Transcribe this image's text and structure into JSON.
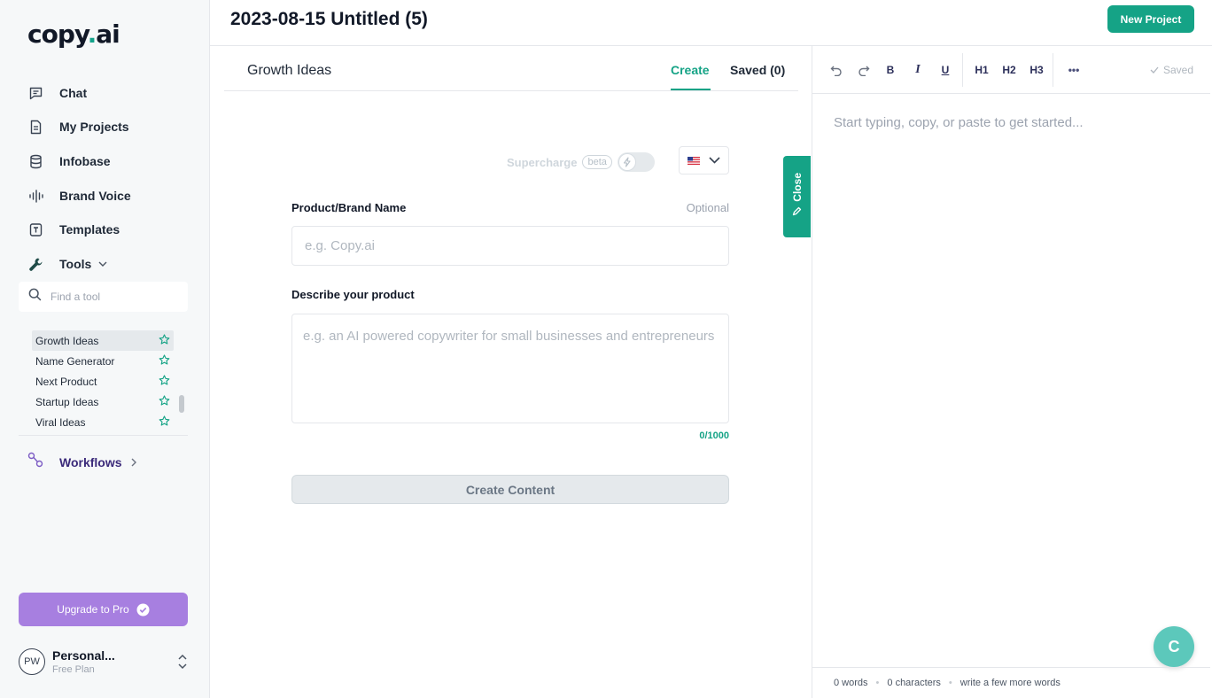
{
  "app": {
    "logo_text": "copy",
    "logo_dot": ".",
    "logo_suffix": "ai",
    "brand_color": "#15a386"
  },
  "sidebar": {
    "nav": [
      {
        "label": "Chat",
        "icon": "chat-icon"
      },
      {
        "label": "My Projects",
        "icon": "document-icon"
      },
      {
        "label": "Infobase",
        "icon": "database-icon"
      },
      {
        "label": "Brand Voice",
        "icon": "waveform-icon"
      },
      {
        "label": "Templates",
        "icon": "template-icon"
      },
      {
        "label": "Tools",
        "icon": "wrench-icon"
      }
    ],
    "tool_search_placeholder": "Find a tool",
    "tools": [
      {
        "label": "Growth Ideas",
        "active": true
      },
      {
        "label": "Name Generator",
        "active": false
      },
      {
        "label": "Next Product",
        "active": false
      },
      {
        "label": "Startup Ideas",
        "active": false
      },
      {
        "label": "Viral Ideas",
        "active": false
      }
    ],
    "workflows_label": "Workflows",
    "upgrade_label": "Upgrade to Pro",
    "account": {
      "initials": "PW",
      "name": "Personal...",
      "plan": "Free Plan"
    }
  },
  "header": {
    "title": "2023-08-15 Untitled (5)",
    "new_project_label": "New Project"
  },
  "form": {
    "tool_title": "Growth Ideas",
    "tabs": {
      "create": "Create",
      "saved": "Saved (0)"
    },
    "supercharge_label": "Supercharge",
    "beta_label": "beta",
    "product_label": "Product/Brand Name",
    "optional_label": "Optional",
    "product_placeholder": "e.g. Copy.ai",
    "describe_label": "Describe your product",
    "describe_placeholder": "e.g. an AI powered copywriter for small businesses and entrepreneurs",
    "counter": "0/1000",
    "create_button": "Create Content",
    "close_tab_label": "Close"
  },
  "editor": {
    "toolbar": {
      "bold": "B",
      "italic": "I",
      "underline": "U",
      "h1": "H1",
      "h2": "H2",
      "h3": "H3",
      "more": "•••",
      "saved_status": "Saved"
    },
    "placeholder": "Start typing, copy, or paste to get started...",
    "footer": {
      "words": "0 words",
      "characters": "0 characters",
      "hint": "write a few more words"
    },
    "fab_label": "C"
  }
}
